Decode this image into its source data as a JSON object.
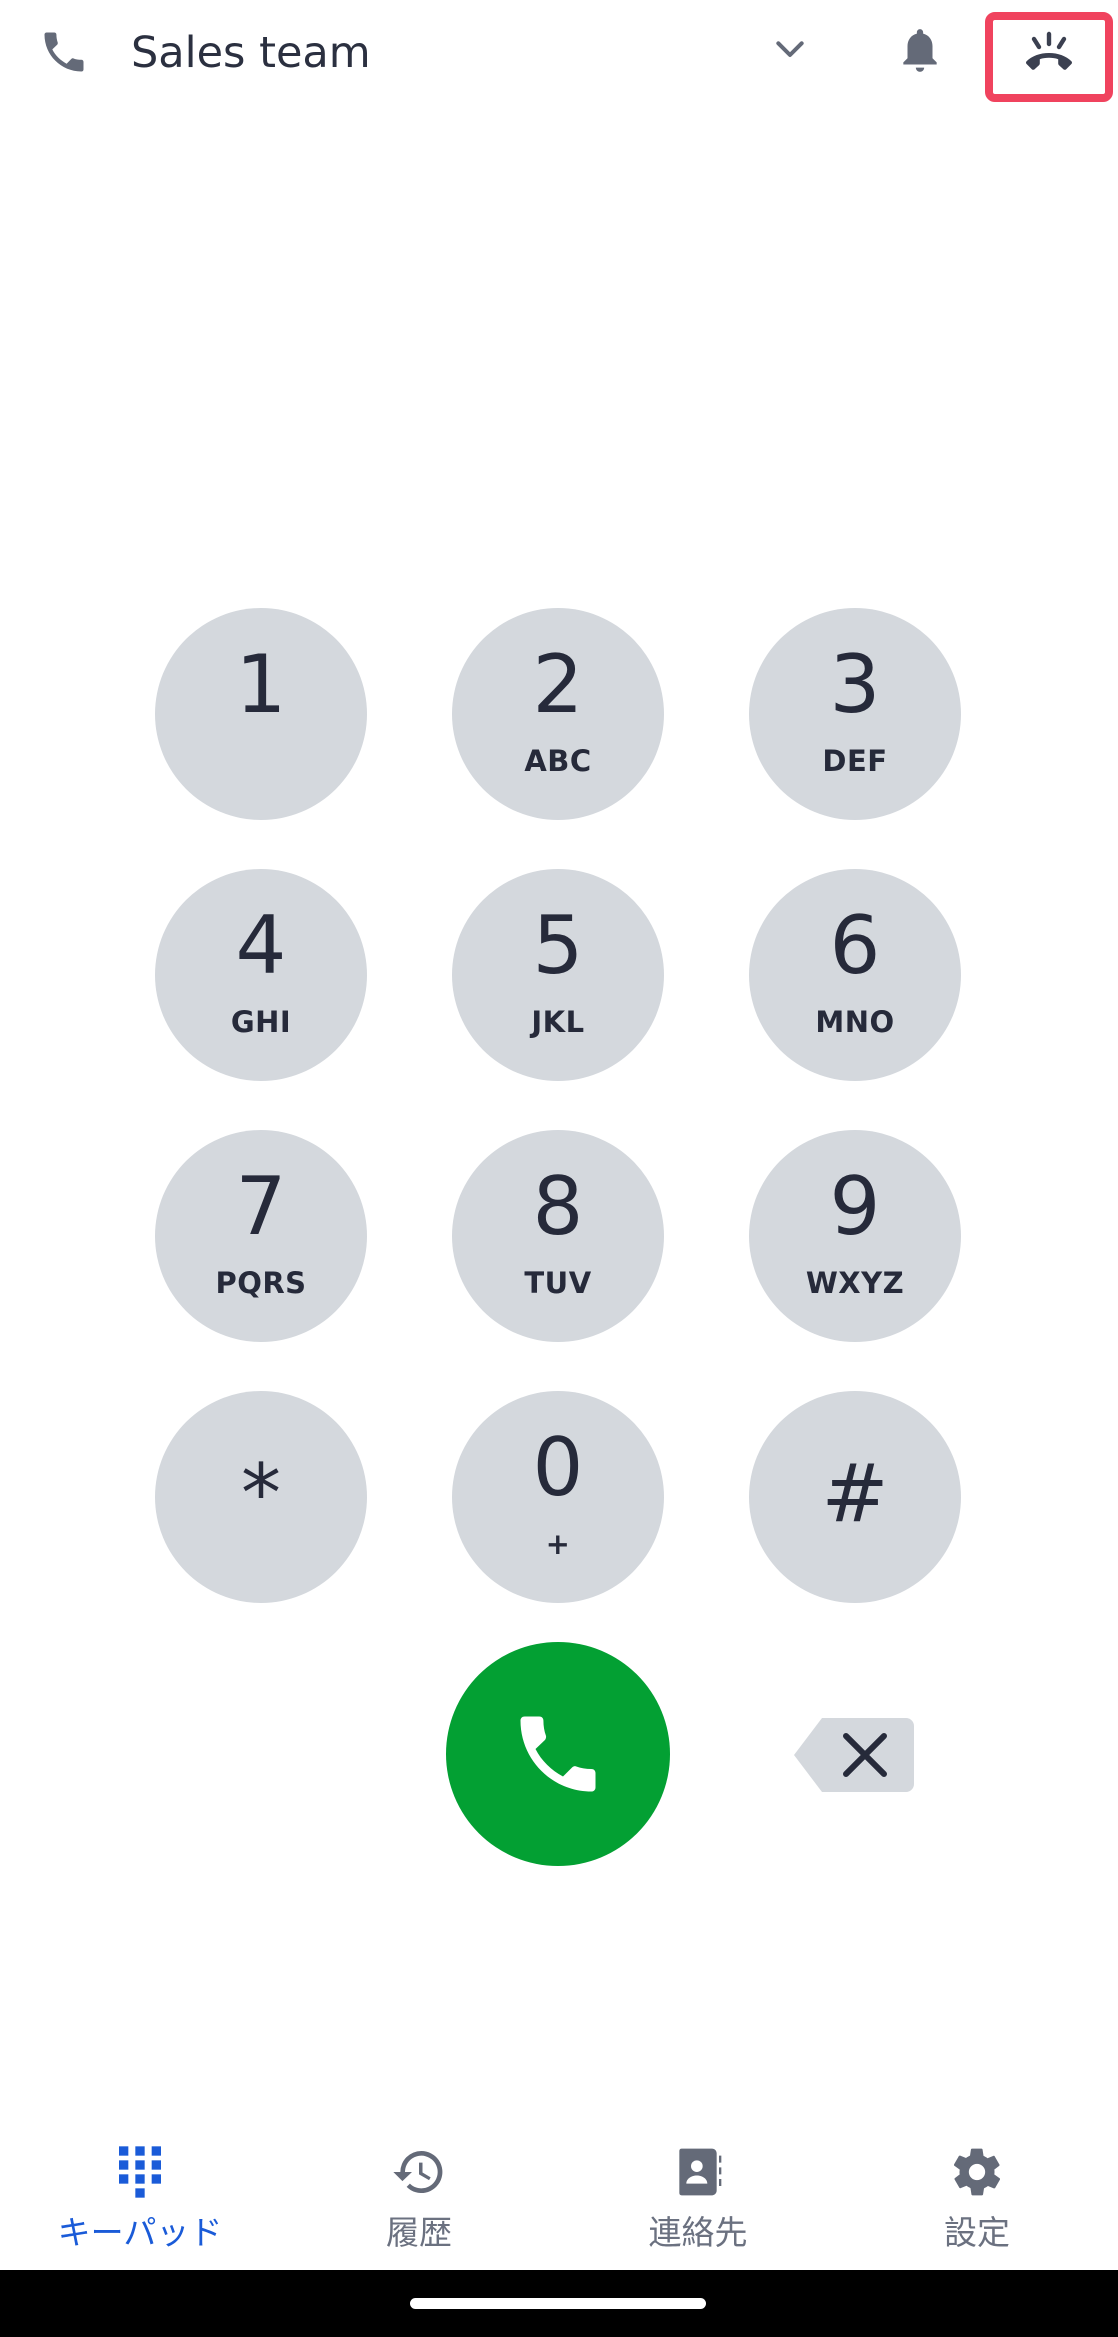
{
  "header": {
    "title": "Sales team",
    "icons": [
      "phone-icon",
      "chevron-down-icon",
      "bell-icon",
      "hang-up-icon"
    ],
    "highlight_color": "#f0435e"
  },
  "keypad": {
    "keys": [
      {
        "digit": "1",
        "letters": ""
      },
      {
        "digit": "2",
        "letters": "ABC"
      },
      {
        "digit": "3",
        "letters": "DEF"
      },
      {
        "digit": "4",
        "letters": "GHI"
      },
      {
        "digit": "5",
        "letters": "JKL"
      },
      {
        "digit": "6",
        "letters": "MNO"
      },
      {
        "digit": "7",
        "letters": "PQRS"
      },
      {
        "digit": "8",
        "letters": "TUV"
      },
      {
        "digit": "9",
        "letters": "WXYZ"
      },
      {
        "digit": "*",
        "letters": ""
      },
      {
        "digit": "0",
        "letters": "+"
      },
      {
        "digit": "#",
        "letters": ""
      }
    ],
    "key_color": "#d4d8dd",
    "call_color": "#03a033"
  },
  "nav": {
    "items": [
      {
        "label": "キーパッド",
        "icon": "dialpad-icon",
        "active": true
      },
      {
        "label": "履歴",
        "icon": "history-icon",
        "active": false
      },
      {
        "label": "連絡先",
        "icon": "contacts-icon",
        "active": false
      },
      {
        "label": "設定",
        "icon": "settings-icon",
        "active": false
      }
    ],
    "active_color": "#1a5bd8",
    "inactive_color": "#6b7180"
  }
}
